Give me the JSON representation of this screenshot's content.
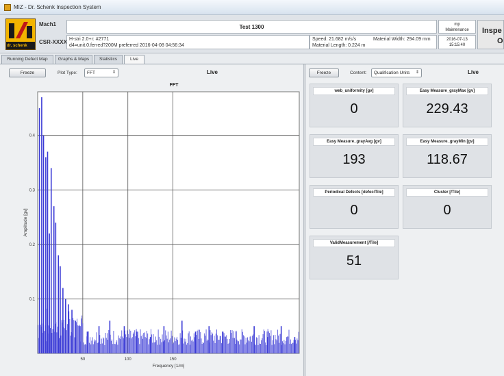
{
  "window": {
    "title": "MIZ - Dr. Schenk Inspection System"
  },
  "header": {
    "logo_label": "dr. schenk",
    "machine_name": "Mach1",
    "system_code": "CSR-XXXX",
    "recipe": "Test 1300",
    "info_line1": "H-stri 2.0+r:  #2771",
    "info_line2": "d4=unit.0.ferred?200M preferred 2016-04-08 04:56:34",
    "speed": "Speed:  21.682 m/s/s",
    "material_width": "Material Width:  294.09 mm",
    "material_length": "Material Length:  0.224 m",
    "mode_line1": "mp",
    "mode_line2": "Maintenance",
    "date": "2016-07-13",
    "time": "15:15:40",
    "status_line1": "Inspe",
    "status_line2": "O"
  },
  "tabs": [
    {
      "label": "Running Defect Map",
      "active": false
    },
    {
      "label": "Graphs & Maps",
      "active": false
    },
    {
      "label": "Statistics",
      "active": false
    },
    {
      "label": "Live",
      "active": true
    }
  ],
  "left_panel": {
    "freeze_label": "Freeze",
    "plot_type_label": "Plot Type:",
    "plot_type_value": "FFT",
    "live_label": "Live"
  },
  "right_panel": {
    "freeze_label": "Freeze",
    "content_label": "Content:",
    "content_value": "Qualification Units",
    "live_label": "Live"
  },
  "tiles": [
    {
      "name": "web_uniformity [gv]",
      "value": "0"
    },
    {
      "name": "Easy Measure_grayMax [gv]",
      "value": "229.43"
    },
    {
      "name": "Easy Measure_grayAvg [gv]",
      "value": "193"
    },
    {
      "name": "Easy Measure_grayMin [gv]",
      "value": "118.67"
    },
    {
      "name": "Periodical Defects [defec/Tile]",
      "value": "0"
    },
    {
      "name": "Cluster [/Tile]",
      "value": "0"
    },
    {
      "name": "ValidMeasurement [/Tile]",
      "value": "51"
    }
  ],
  "chart_data": {
    "type": "bar",
    "title": "FFT",
    "xlabel": "Frequency [1/m]",
    "ylabel": "Amplitude [gv]",
    "xlim": [
      0,
      290
    ],
    "ylim": [
      0,
      0.48
    ],
    "xticks": [
      50,
      100,
      150
    ],
    "yticks": [
      0.1,
      0.2,
      0.3,
      0.4
    ],
    "ytick_labels": [
      "0.1",
      "0.2",
      "0.3",
      "0.4"
    ],
    "grid": true,
    "series_color": "#3b3bd6",
    "peaks": [
      {
        "x": 2.0,
        "y": 0.45
      },
      {
        "x": 4.5,
        "y": 0.47
      },
      {
        "x": 6.5,
        "y": 0.4
      },
      {
        "x": 9.0,
        "y": 0.36
      },
      {
        "x": 11.0,
        "y": 0.37
      },
      {
        "x": 13.0,
        "y": 0.22
      },
      {
        "x": 15.0,
        "y": 0.34
      },
      {
        "x": 18.0,
        "y": 0.27
      },
      {
        "x": 20.0,
        "y": 0.24
      },
      {
        "x": 23.0,
        "y": 0.18
      },
      {
        "x": 25.0,
        "y": 0.16
      },
      {
        "x": 28.0,
        "y": 0.12
      },
      {
        "x": 31.0,
        "y": 0.1
      },
      {
        "x": 34.0,
        "y": 0.09
      },
      {
        "x": 38.0,
        "y": 0.08
      },
      {
        "x": 42.0,
        "y": 0.06
      },
      {
        "x": 47.0,
        "y": 0.05
      },
      {
        "x": 55.0,
        "y": 0.04
      },
      {
        "x": 68.0,
        "y": 0.05
      },
      {
        "x": 80.0,
        "y": 0.06
      },
      {
        "x": 96.0,
        "y": 0.05
      },
      {
        "x": 110.0,
        "y": 0.04
      },
      {
        "x": 125.0,
        "y": 0.03
      },
      {
        "x": 140.0,
        "y": 0.05
      },
      {
        "x": 160.0,
        "y": 0.06
      },
      {
        "x": 175.0,
        "y": 0.04
      },
      {
        "x": 190.0,
        "y": 0.05
      },
      {
        "x": 205.0,
        "y": 0.04
      },
      {
        "x": 220.0,
        "y": 0.04
      },
      {
        "x": 240.0,
        "y": 0.05
      },
      {
        "x": 255.0,
        "y": 0.03
      },
      {
        "x": 270.0,
        "y": 0.05
      },
      {
        "x": 285.0,
        "y": 0.03
      }
    ]
  }
}
